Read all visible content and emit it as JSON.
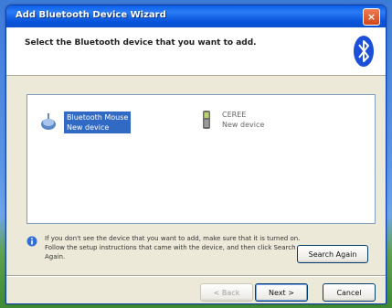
{
  "window": {
    "title": "Add Bluetooth Device Wizard",
    "close_glyph": "×"
  },
  "header": {
    "instruction": "Select the Bluetooth device that you want to add."
  },
  "devices": [
    {
      "name": "Bluetooth Mouse",
      "status": "New device",
      "icon": "mouse-icon"
    },
    {
      "name": "CEREE",
      "status": "New device",
      "icon": "phone-icon"
    }
  ],
  "tip": {
    "text": "If you don't see the device that you want to add, make sure that it is turned on. Follow the setup instructions that came with the device, and then click Search Again.",
    "icon": "info-icon"
  },
  "buttons": {
    "search_again": "Search Again",
    "back": "< Back",
    "next": "Next >",
    "cancel": "Cancel"
  },
  "colors": {
    "accent": "#0a56dc",
    "selection": "#316ac5",
    "bluetooth": "#1c4fd8"
  }
}
